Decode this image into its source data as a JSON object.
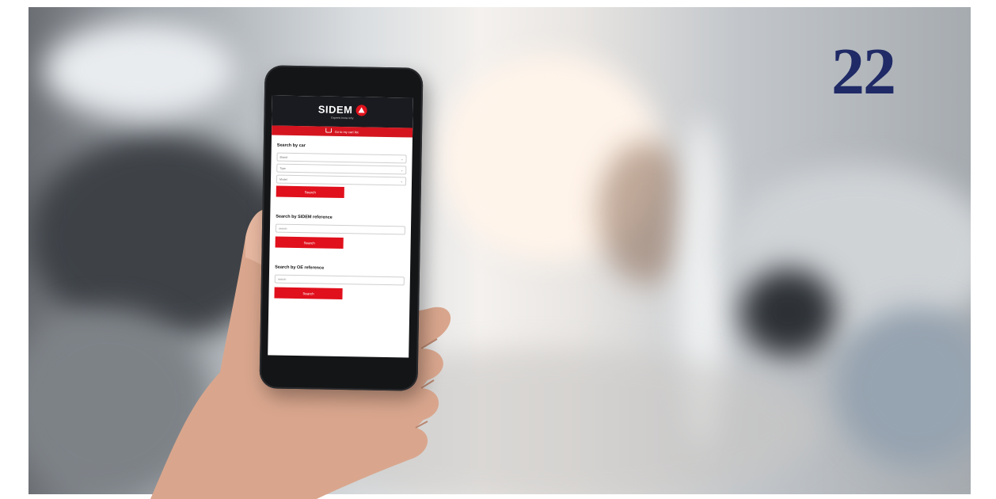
{
  "page": {
    "number": "22"
  },
  "app": {
    "logo_text": "SIDEM",
    "tagline": "Experts know why",
    "cart_text": "Go to my cart list"
  },
  "search_by_car": {
    "title": "Search by car",
    "selects": [
      {
        "value": "Brand"
      },
      {
        "value": "Type"
      },
      {
        "value": "Model"
      }
    ],
    "button": "Search"
  },
  "search_by_sidem": {
    "title": "Search by SIDEM reference",
    "placeholder": "search",
    "button": "Search"
  },
  "search_by_oe": {
    "title": "Search by OE reference",
    "placeholder": "search",
    "button": "Search"
  },
  "colors": {
    "brand_red": "#e0101c",
    "header_dark": "#1a1b20",
    "page_number": "#1f2a66"
  }
}
